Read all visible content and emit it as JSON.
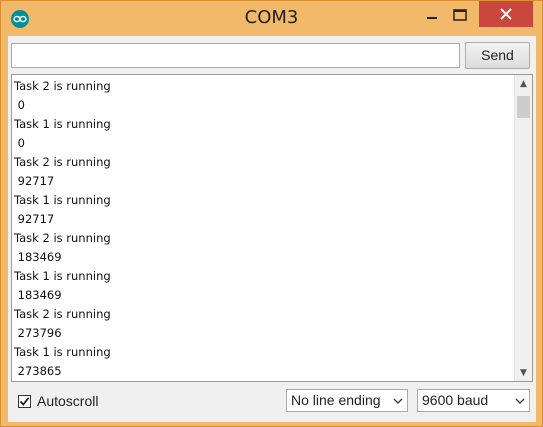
{
  "window": {
    "title": "COM3",
    "icon": "arduino-icon"
  },
  "input": {
    "value": "",
    "placeholder": ""
  },
  "send_button_label": "Send",
  "serial_output": [
    "Task 2 is running",
    " 0",
    "Task 1 is running",
    " 0",
    "Task 2 is running",
    " 92717",
    "Task 1 is running",
    " 92717",
    "Task 2 is running",
    " 183469",
    "Task 1 is running",
    " 183469",
    "Task 2 is running",
    " 273796",
    "Task 1 is running",
    " 273865"
  ],
  "autoscroll": {
    "label": "Autoscroll",
    "checked": true
  },
  "line_ending": {
    "selected": "No line ending"
  },
  "baud_rate": {
    "selected": "9600 baud"
  },
  "colors": {
    "titlebar": "#f3b96b",
    "close_button": "#c9473d",
    "icon_teal": "#008f96"
  }
}
